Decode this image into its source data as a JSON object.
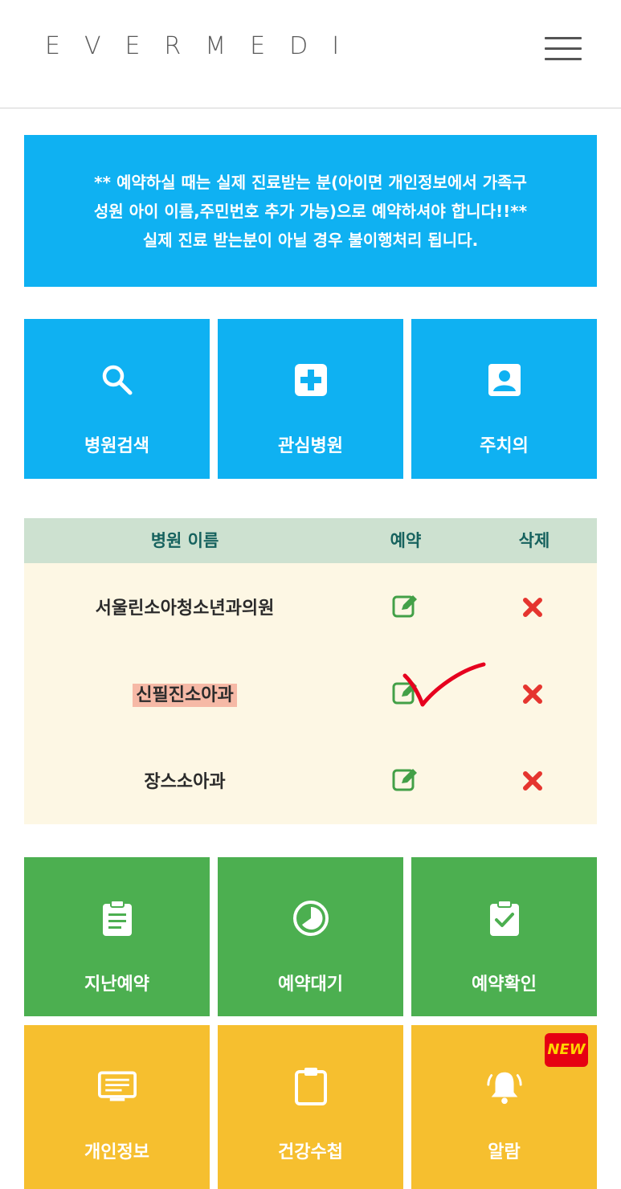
{
  "header": {
    "logo": "EVERMEDI"
  },
  "notice": {
    "line1": "** 예약하실 때는 실제 진료받는 분(아이면 개인정보에서 가족구",
    "line2": "성원 아이 이름,주민번호 추가 가능)으로 예약하셔야 합니다!!**",
    "line3": "실제 진료 받는분이 아닐 경우 불이행처리 됩니다."
  },
  "top_tiles": [
    {
      "label": "병원검색",
      "icon": "search-icon"
    },
    {
      "label": "관심병원",
      "icon": "plus-square-icon"
    },
    {
      "label": "주치의",
      "icon": "person-card-icon"
    }
  ],
  "table": {
    "headers": {
      "name": "병원 이름",
      "reserve": "예약",
      "delete": "삭제"
    },
    "rows": [
      {
        "name": "서울린소아청소년과의원",
        "highlighted": false
      },
      {
        "name": "신필진소아과",
        "highlighted": true
      },
      {
        "name": "장스소아과",
        "highlighted": false
      }
    ]
  },
  "green_tiles": [
    {
      "label": "지난예약",
      "icon": "clipboard-list-icon"
    },
    {
      "label": "예약대기",
      "icon": "clock-icon"
    },
    {
      "label": "예약확인",
      "icon": "clipboard-check-icon"
    }
  ],
  "yellow_tiles": [
    {
      "label": "개인정보",
      "icon": "id-card-icon"
    },
    {
      "label": "건강수첩",
      "icon": "clipboard-icon"
    },
    {
      "label": "알람",
      "icon": "bell-icon"
    }
  ],
  "badge": {
    "new": "NEW"
  },
  "colors": {
    "blue": "#0fb1f2",
    "green": "#4caf50",
    "yellow": "#f6bf2f",
    "table_header_bg": "#cde1d0",
    "table_body_bg": "#fdf7e4",
    "highlight": "#f6b9a6",
    "delete_red": "#e5352f",
    "edit_green": "#43a047"
  }
}
